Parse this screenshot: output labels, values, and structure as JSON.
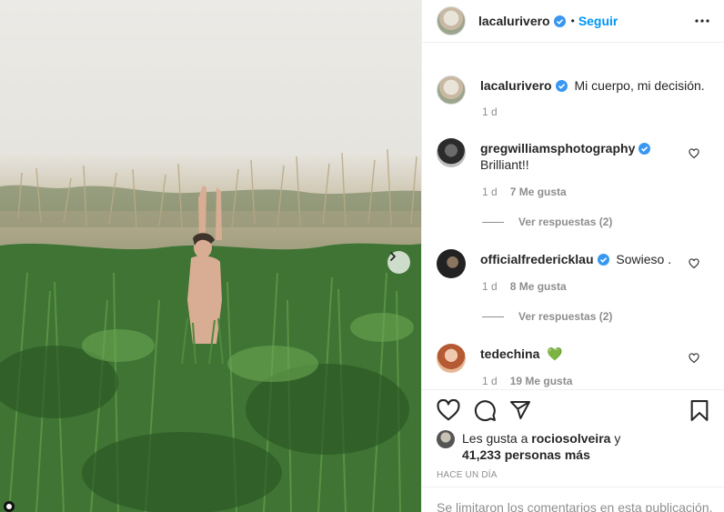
{
  "post": {
    "username": "lacalurivero",
    "follow_label": "Seguir",
    "separator": "•"
  },
  "caption": {
    "username": "lacalurivero",
    "text": "Mi cuerpo, mi decisión.",
    "time": "1 d"
  },
  "comments": [
    {
      "username": "gregwilliamsphotography",
      "verified": true,
      "text": "Brilliant!!",
      "time": "1 d",
      "likes": "7 Me gusta",
      "replies": "Ver respuestas (2)"
    },
    {
      "username": "officialfredericklau",
      "verified": true,
      "text": "Sowieso .",
      "time": "1 d",
      "likes": "8 Me gusta",
      "replies": "Ver respuestas (2)"
    },
    {
      "username": "tedechina",
      "verified": false,
      "text": "💚",
      "time": "1 d",
      "likes": "19 Me gusta"
    }
  ],
  "likes_line": {
    "prefix": "Les gusta a",
    "user": "rociosolveira",
    "conj": "y",
    "count": "41,233 personas más"
  },
  "timestamp": "HACE UN DÍA",
  "comments_limited": "Se limitaron los comentarios en esta publicación.",
  "colors": {
    "link": "#0095f6",
    "verified": "#3897f0",
    "muted": "#8e8e8e",
    "text": "#262626"
  },
  "icons": [
    "verified-icon",
    "more-icon",
    "heart-icon",
    "comment-icon",
    "share-icon",
    "bookmark-icon",
    "chevron-right-icon"
  ]
}
